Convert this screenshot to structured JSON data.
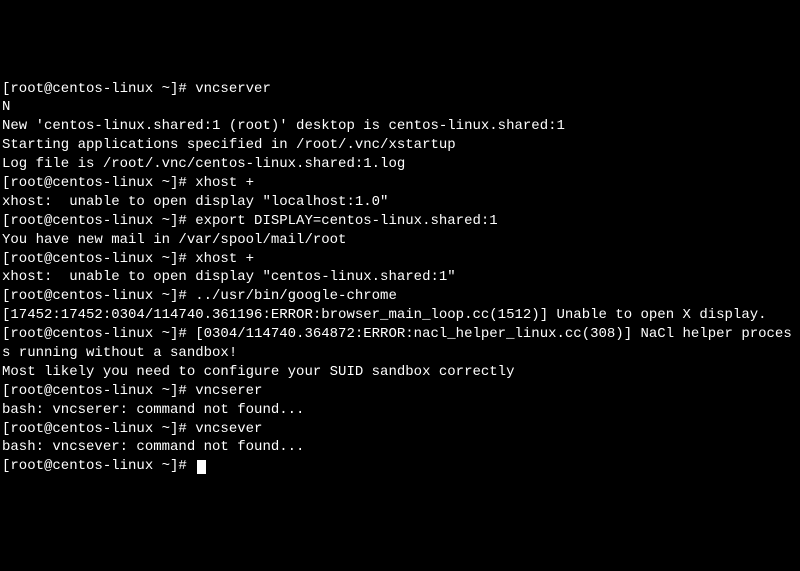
{
  "terminal": {
    "lines": [
      "[root@centos-linux ~]# vncserver",
      "N",
      "New 'centos-linux.shared:1 (root)' desktop is centos-linux.shared:1",
      "",
      "Starting applications specified in /root/.vnc/xstartup",
      "Log file is /root/.vnc/centos-linux.shared:1.log",
      "",
      "[root@centos-linux ~]# xhost +",
      "xhost:  unable to open display \"localhost:1.0\"",
      "[root@centos-linux ~]# export DISPLAY=centos-linux.shared:1",
      "You have new mail in /var/spool/mail/root",
      "[root@centos-linux ~]# xhost +",
      "xhost:  unable to open display \"centos-linux.shared:1\"",
      "[root@centos-linux ~]# ../usr/bin/google-chrome",
      "[17452:17452:0304/114740.361196:ERROR:browser_main_loop.cc(1512)] Unable to open X display.",
      "[root@centos-linux ~]# [0304/114740.364872:ERROR:nacl_helper_linux.cc(308)] NaCl helper process running without a sandbox!",
      "Most likely you need to configure your SUID sandbox correctly",
      "",
      "[root@centos-linux ~]# vncserer",
      "bash: vncserer: command not found...",
      "[root@centos-linux ~]# vncsever",
      "bash: vncsever: command not found...",
      "[root@centos-linux ~]# "
    ]
  }
}
